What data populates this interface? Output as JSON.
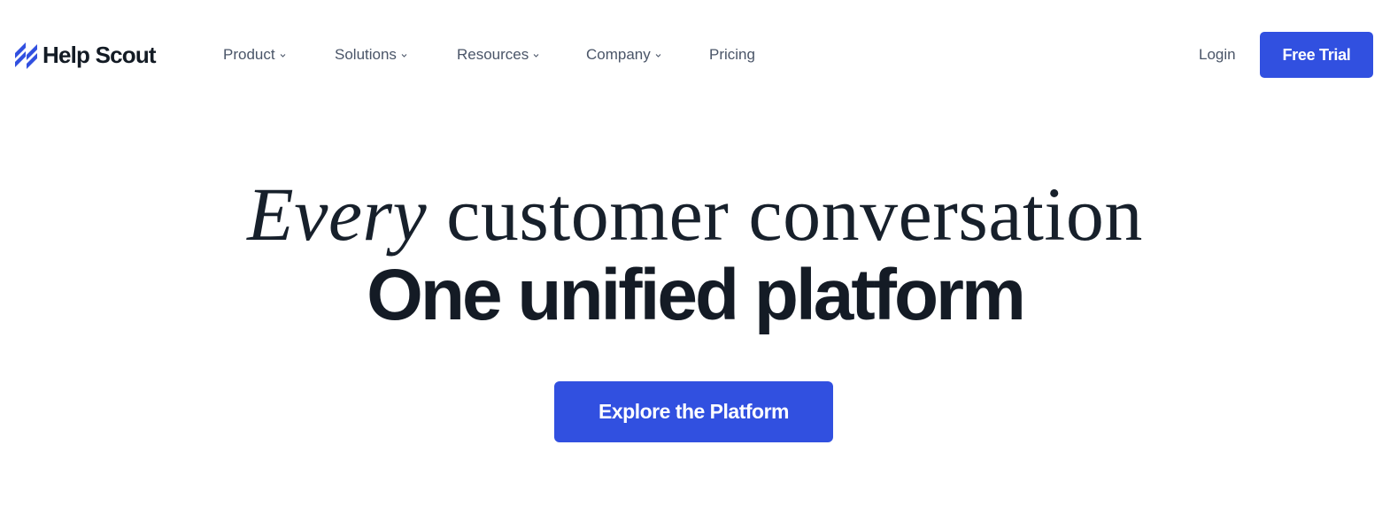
{
  "brand": {
    "name": "Help Scout",
    "logo_icon": "help-scout-stripes-icon",
    "accent_color": "#3150e0"
  },
  "nav": {
    "items": [
      {
        "label": "Product",
        "has_dropdown": true
      },
      {
        "label": "Solutions",
        "has_dropdown": true
      },
      {
        "label": "Resources",
        "has_dropdown": true
      },
      {
        "label": "Company",
        "has_dropdown": true
      },
      {
        "label": "Pricing",
        "has_dropdown": false
      }
    ],
    "login_label": "Login",
    "trial_label": "Free Trial"
  },
  "hero": {
    "line1_emphasis": "Every",
    "line1_rest": "customer conversation",
    "line2": "One unified platform",
    "cta_label": "Explore the Platform"
  }
}
